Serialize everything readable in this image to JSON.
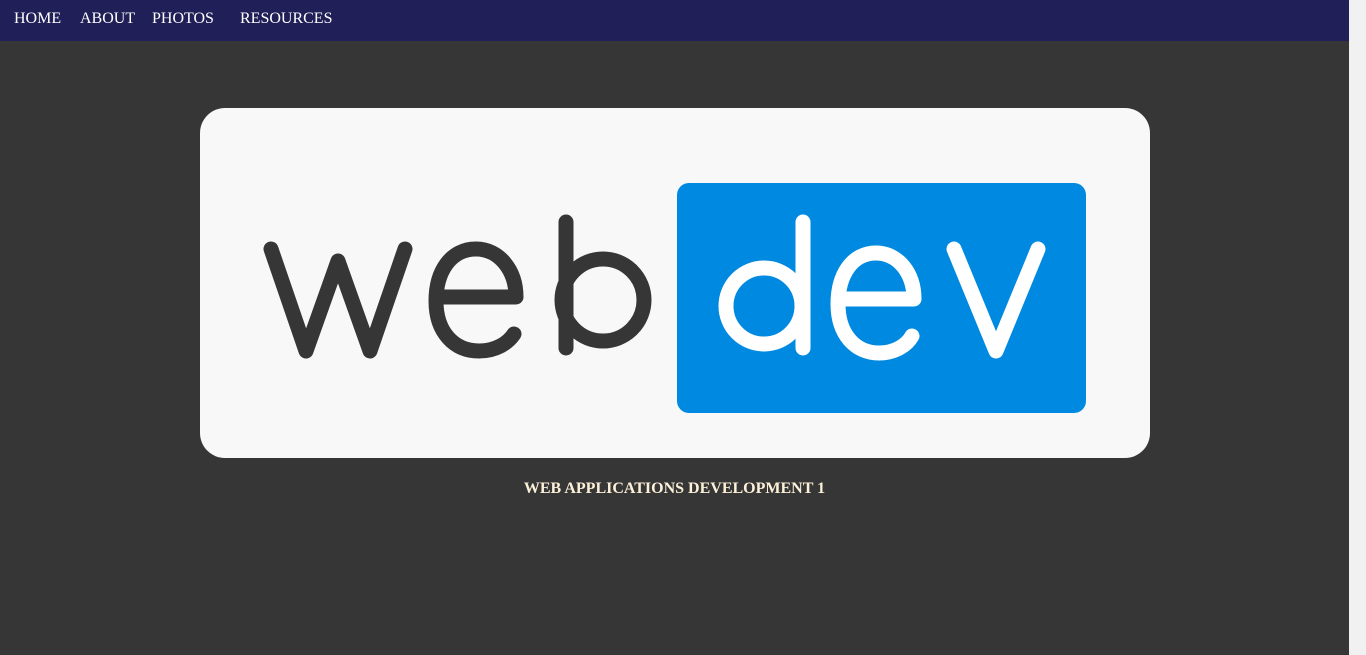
{
  "nav": {
    "items": [
      {
        "label": "HOME"
      },
      {
        "label": "ABOUT"
      },
      {
        "label": "PHOTOS"
      },
      {
        "label": "RESOURCES"
      }
    ]
  },
  "logo": {
    "word_dark": "web",
    "word_light": "dev",
    "dark_color": "#363636",
    "accent_color": "#0089e0"
  },
  "caption": "WEB APPLICATIONS DEVELOPMENT 1",
  "colors": {
    "navbar_bg": "#201f57",
    "page_bg": "#363636",
    "card_bg": "#f8f8f8"
  }
}
